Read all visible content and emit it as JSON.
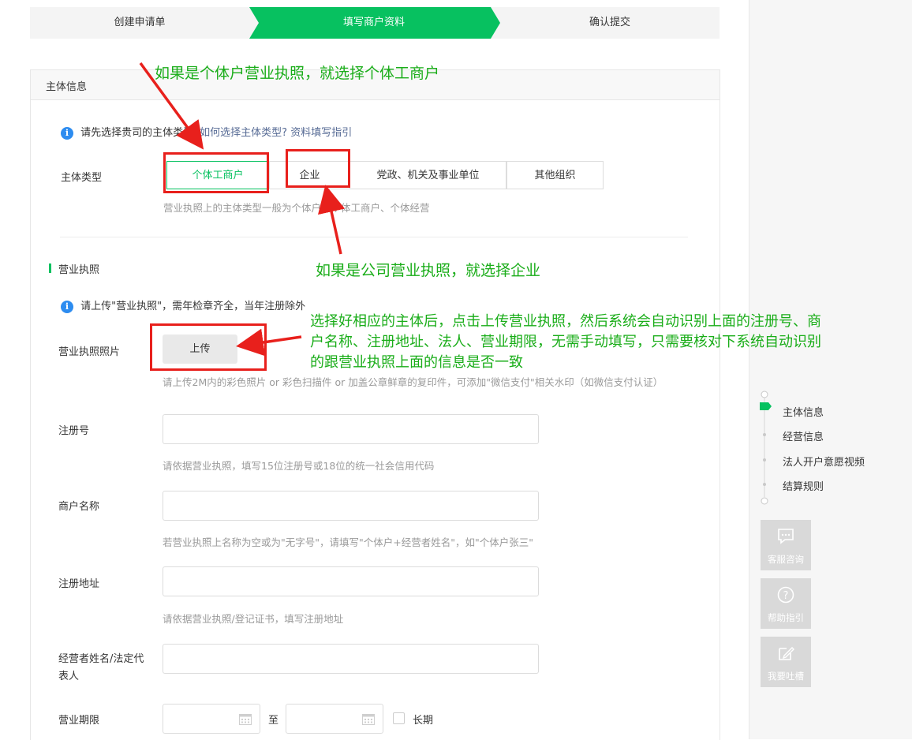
{
  "steps": [
    "创建申请单",
    "填写商户资料",
    "确认提交"
  ],
  "section_title": "主体信息",
  "notice": {
    "text": "请先选择贵司的主体类型",
    "link1": "如何选择主体类型?",
    "link2": "资料填写指引"
  },
  "subject_type": {
    "label": "主体类型",
    "options": [
      "个体工商户",
      "企业",
      "党政、机关及事业单位",
      "其他组织"
    ],
    "hint": "营业执照上的主体类型一般为个体户、个体工商户、个体经营"
  },
  "license_section": {
    "title": "营业执照",
    "notice": "请上传\"营业执照\"，需年检章齐全，当年注册除外",
    "photo_label": "营业执照照片",
    "upload_button": "上传",
    "upload_hint": "请上传2M内的彩色照片 or 彩色扫描件 or 加盖公章鲜章的复印件，可添加\"微信支付\"相关水印（如微信支付认证）"
  },
  "fields": {
    "reg_no": {
      "label": "注册号",
      "value": "",
      "hint": "请依据营业执照，填写15位注册号或18位的统一社会信用代码"
    },
    "merchant_name": {
      "label": "商户名称",
      "value": "",
      "hint": "若营业执照上名称为空或为\"无字号\"，请填写\"个体户+经营者姓名\"，如\"个体户张三\""
    },
    "reg_address": {
      "label": "注册地址",
      "value": "",
      "hint": "请依据营业执照/登记证书，填写注册地址"
    },
    "legal_rep": {
      "label_line1": "经营者姓名/法定代",
      "label_line2": "表人",
      "value": ""
    },
    "period": {
      "label": "营业期限",
      "to": "至",
      "long_term": "长期",
      "start": "",
      "end": ""
    }
  },
  "annotations": {
    "individual": "如果是个体户营业执照，就选择个体工商户",
    "company": "如果是公司营业执照，就选择企业",
    "upload_line1": "选择好相应的主体后，点击上传营业执照，然后系统会自动识别上面的注册号、商",
    "upload_line2": "户名称、注册地址、法人、营业期限，无需手动填写，只需要核对下系统自动识别",
    "upload_line3": "的跟营业执照上面的信息是否一致"
  },
  "side_nav": [
    "主体信息",
    "经营信息",
    "法人开户意愿视频",
    "结算规则"
  ],
  "tools": [
    "客服咨询",
    "帮助指引",
    "我要吐槽"
  ],
  "colors": {
    "accent": "#07c160",
    "annotation": "#1aad19",
    "highlight": "#e8201c",
    "info": "#2d8cf0"
  }
}
